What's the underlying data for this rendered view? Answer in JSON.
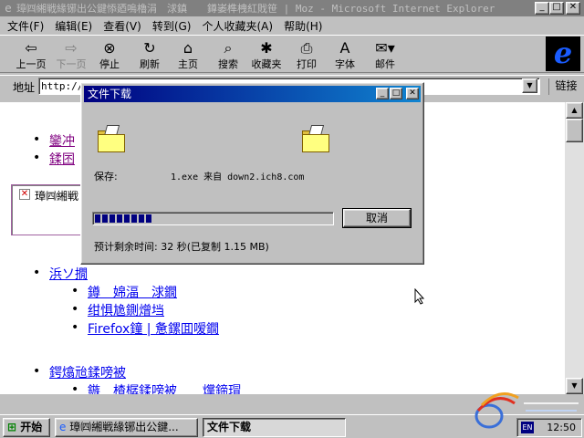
{
  "window": {
    "title": "璋㈣緗戦緣铘出公鍵悿廼嗚櫓涓　浗鎮　　鐏崣榫栧紅戝笹 | Moz - Microsoft Internet Explorer",
    "minimize": "_",
    "maximize": "□",
    "close": "✕"
  },
  "menu": [
    "文件(F)",
    "编辑(E)",
    "查看(V)",
    "转到(G)",
    "个人收藏夹(A)",
    "帮助(H)"
  ],
  "toolbar": {
    "back": "上一页",
    "forward": "下一页",
    "stop": "停止",
    "refresh": "刷新",
    "home": "主页",
    "search": "搜索",
    "favorites": "收藏夹",
    "print": "打印",
    "font": "字体",
    "mail": "邮件"
  },
  "address": {
    "label": "地址",
    "value": "http://",
    "links": "链接"
  },
  "content": {
    "items": [
      {
        "text": "鑾冲",
        "visited": true
      },
      {
        "text": "鍒囨",
        "visited": true
      }
    ],
    "broken_image_alt": "璋㈣緗戦",
    "section1": "浜ソ撊",
    "section1_items": [
      "鐏　婂湢　浗鐗",
      "绀惧尯鍘熷垱",
      "Firefox鐘 | 惫鏍囬嗳鐗"
    ],
    "section2": "鍔熻兘鍒嗙被",
    "section2_items": [
      "鏃　楂樼鍒嗙被　　爣鍗瑁"
    ]
  },
  "dialog": {
    "title": "文件下载",
    "save_label": "保存:",
    "save_value": "1.exe 来自 down2.ich8.com",
    "progress": 0.25,
    "cancel": "取消",
    "eta": "预计剩余时间:  32 秒(已复制 1.15 MB)"
  },
  "taskbar": {
    "start": "开始",
    "task_ie": "璋㈣緗戦緣铘出公鍵...",
    "task_download": "文件下载",
    "clock": "12:50"
  },
  "colors": {
    "desktop_gray": "#c0c0c0",
    "titlebar_active": "#000080",
    "link": "#0000ee",
    "visited": "#800080"
  }
}
